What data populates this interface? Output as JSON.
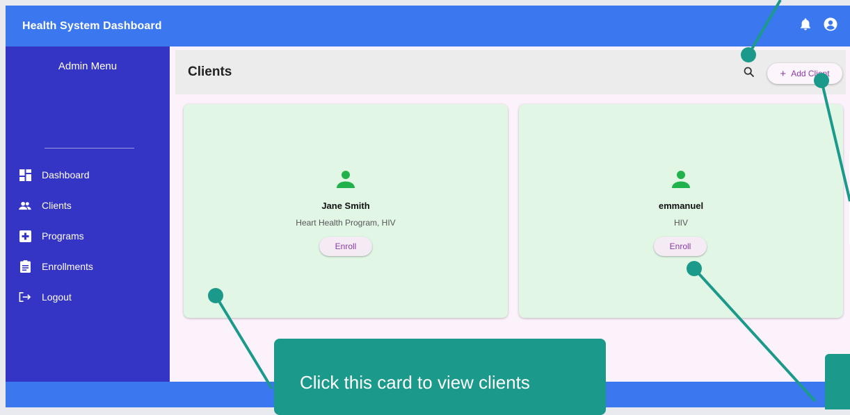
{
  "app": {
    "title": "Health System Dashboard"
  },
  "sidebar": {
    "title": "Admin Menu",
    "items": [
      {
        "label": "Dashboard",
        "icon": "dashboard-icon"
      },
      {
        "label": "Clients",
        "icon": "people-icon"
      },
      {
        "label": "Programs",
        "icon": "medical-plus-icon"
      },
      {
        "label": "Enrollments",
        "icon": "clipboard-icon"
      },
      {
        "label": "Logout",
        "icon": "logout-icon"
      }
    ]
  },
  "header": {
    "title": "Clients",
    "add_label": "Add Client",
    "search_icon": "search-icon"
  },
  "clients": [
    {
      "name": "Jane Smith",
      "programs": "Heart Health Program, HIV",
      "enroll_label": "Enroll"
    },
    {
      "name": "emmanuel",
      "programs": "HIV",
      "enroll_label": "Enroll"
    }
  ],
  "annotation": {
    "text": "Click this card to view clients"
  },
  "colors": {
    "topbar": "#3b78f0",
    "sidebar": "#3535c5",
    "card": "#e1f6e5",
    "accent": "#8a3aa5",
    "annotation": "#1b998b",
    "person_icon": "#22b24c"
  }
}
